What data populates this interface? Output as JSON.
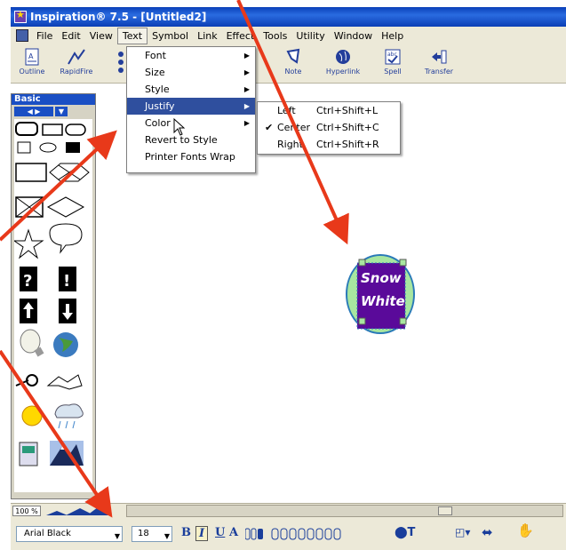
{
  "window": {
    "title": "Inspiration® 7.5 - [Untitled2]"
  },
  "menubar": {
    "items": [
      "File",
      "Edit",
      "View",
      "Text",
      "Symbol",
      "Link",
      "Effect",
      "Tools",
      "Utility",
      "Window",
      "Help"
    ],
    "active": "Text"
  },
  "toolbar": {
    "items": [
      "Outline",
      "RapidFire",
      "Note",
      "Hyperlink",
      "Spell",
      "Transfer"
    ]
  },
  "text_menu": {
    "items": [
      "Font",
      "Size",
      "Style",
      "Justify",
      "Color",
      "Revert to Style",
      "Printer Fonts Wrap"
    ],
    "selected": "Justify"
  },
  "justify_submenu": {
    "items": [
      {
        "label": "Left",
        "shortcut": "Ctrl+Shift+L",
        "checked": false
      },
      {
        "label": "Center",
        "shortcut": "Ctrl+Shift+C",
        "checked": true
      },
      {
        "label": "Right",
        "shortcut": "Ctrl+Shift+R",
        "checked": false
      }
    ]
  },
  "palette": {
    "title": "Basic"
  },
  "canvas": {
    "symbol_text_line1": "Snow",
    "symbol_text_line2": "White",
    "symbol_fill": "#5a0a9a",
    "circle_fill": "#a8e6a0"
  },
  "status": {
    "zoom": "100 %"
  },
  "format": {
    "font": "Arial Black",
    "size": "18"
  },
  "colors": {
    "title_bar": "#0a3fb8",
    "menu_highlight": "#2f4f9e",
    "arrow": "#e8391a"
  }
}
